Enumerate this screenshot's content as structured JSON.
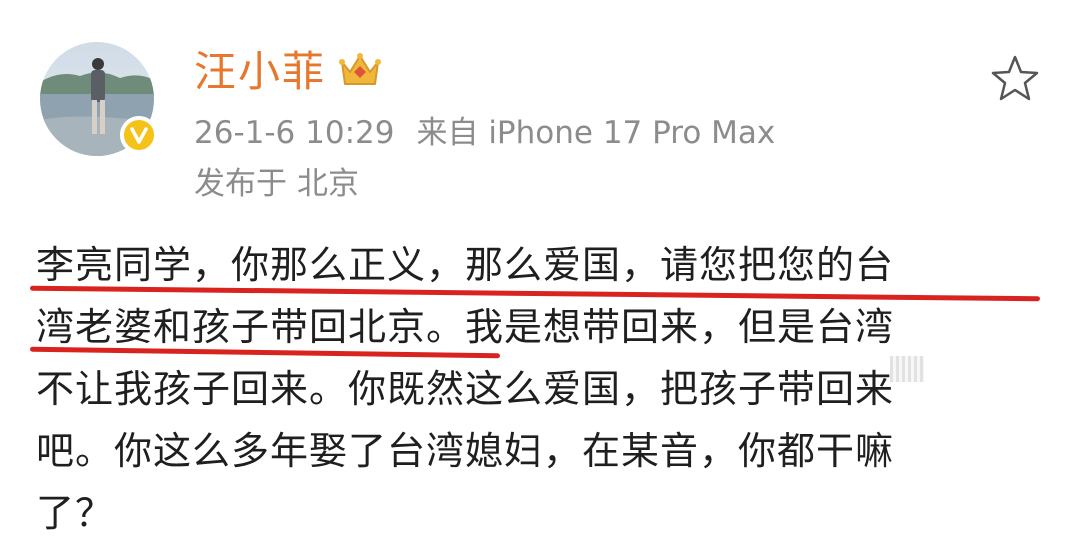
{
  "post": {
    "username": "汪小菲",
    "timestamp": "26-1-6 10:29",
    "source": "来自 iPhone 17 Pro Max",
    "location_prefix": "发布于",
    "location": "北京",
    "content_lines": [
      "李亮同学，你那么正义，那么爱国，请您把您的台",
      "湾老婆和孩子带回北京。我是想带回来，但是台湾",
      "不让我孩子回来。你既然这么爱国，把孩子带回来",
      "吧。你这么多年娶了台湾媳妇，在某音，你都干嘛",
      "了？"
    ]
  },
  "icons": {
    "avatar": "avatar-photo",
    "verified": "verified-badge-icon",
    "crown": "crown-icon",
    "favorite": "star-icon"
  },
  "colors": {
    "username": "#e8772e",
    "meta": "#8c8c8c",
    "text": "#1f1f1f",
    "underline": "#d9231f",
    "verified": "#f5c21a"
  }
}
